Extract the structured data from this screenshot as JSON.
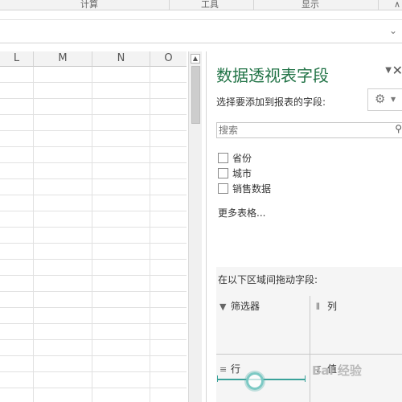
{
  "ribbon": {
    "groups": [
      "计算",
      "工具",
      "显示"
    ],
    "collapse_glyph": "∧"
  },
  "formula_bar": {
    "expand_glyph": "⌄"
  },
  "grid": {
    "columns": [
      "L",
      "M",
      "N",
      "O"
    ],
    "row_count": 21
  },
  "pivot_pane": {
    "title": "数据透视表字段",
    "subtitle": "选择要添加到报表的字段:",
    "close_glyph": "✕",
    "dropdown_glyph": "▼",
    "settings_icon": "gear-icon",
    "search": {
      "placeholder": "搜索",
      "value": ""
    },
    "fields": [
      {
        "label": "省份",
        "checked": false
      },
      {
        "label": "城市",
        "checked": false
      },
      {
        "label": "销售数据",
        "checked": false
      }
    ],
    "more_tables": "更多表格...",
    "areas_caption": "在以下区域间拖动字段:",
    "areas": {
      "filters": {
        "label": "筛选器",
        "icon": "filter-icon"
      },
      "columns": {
        "label": "列",
        "icon": "columns-icon"
      },
      "rows": {
        "label": "行",
        "icon": "rows-icon"
      },
      "values": {
        "label": "值",
        "icon": "sigma-icon"
      }
    }
  },
  "watermark_text": "Bai 经验"
}
